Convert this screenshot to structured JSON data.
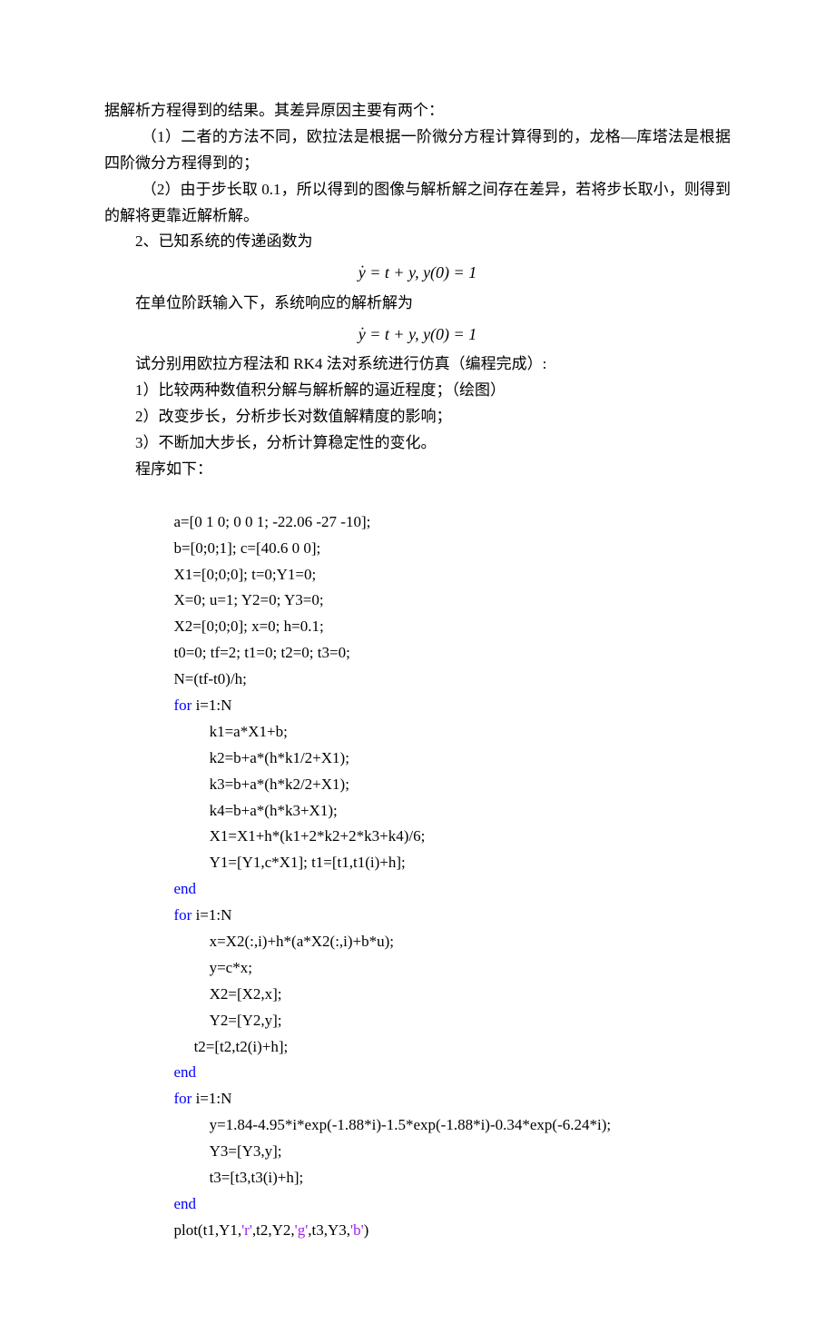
{
  "p1": "据解析方程得到的结果。其差异原因主要有两个：",
  "p2": "（1）二者的方法不同，欧拉法是根据一阶微分方程计算得到的，龙格—库塔法是根据四阶微分方程得到的；",
  "p3": "（2）由于步长取 0.1，所以得到的图像与解析解之间存在差异，若将步长取小，则得到的解将更靠近解析解。",
  "p4": "2、已知系统的传递函数为",
  "eq1_lhs": "y",
  "eq1_rhs": " = t + y, y(0) = 1",
  "p5": "在单位阶跃输入下，系统响应的解析解为",
  "eq2_lhs": "y",
  "eq2_rhs": " = t + y, y(0) = 1",
  "p6": "试分别用欧拉方程法和 RK4 法对系统进行仿真（编程完成）:",
  "p7": "1）比较两种数值积分解与解析解的逼近程度；（绘图）",
  "p8": "2）改变步长，分析步长对数值解精度的影响；",
  "p9": "3）不断加大步长，分析计算稳定性的变化。",
  "p10": "程序如下：",
  "code": {
    "l1": "a=[0 1 0; 0 0 1; -22.06 -27 -10];",
    "l2": "b=[0;0;1]; c=[40.6 0 0];",
    "l3": "X1=[0;0;0]; t=0;Y1=0;",
    "l4": "X=0; u=1; Y2=0; Y3=0;",
    "l5": "X2=[0;0;0]; x=0; h=0.1;",
    "l6": "t0=0; tf=2; t1=0; t2=0; t3=0;",
    "l7": "N=(tf-t0)/h;",
    "l8a": "for",
    "l8b": " i=1:N",
    "l9": "k1=a*X1+b;",
    "l10": "k2=b+a*(h*k1/2+X1);",
    "l11": "k3=b+a*(h*k2/2+X1);",
    "l12": "k4=b+a*(h*k3+X1);",
    "l13": "X1=X1+h*(k1+2*k2+2*k3+k4)/6;",
    "l14": "Y1=[Y1,c*X1]; t1=[t1,t1(i)+h];",
    "l15": "end",
    "l16a": "for",
    "l16b": " i=1:N",
    "l17": "x=X2(:,i)+h*(a*X2(:,i)+b*u);",
    "l18": "y=c*x;",
    "l19": "X2=[X2,x];",
    "l20": "Y2=[Y2,y];",
    "l21": "t2=[t2,t2(i)+h];",
    "l22": "end",
    "l23a": "for",
    "l23b": " i=1:N",
    "l24": "y=1.84-4.95*i*exp(-1.88*i)-1.5*exp(-1.88*i)-0.34*exp(-6.24*i);",
    "l25": "Y3=[Y3,y];",
    "l26": "t3=[t3,t3(i)+h];",
    "l27": "end",
    "l28a": "plot(t1,Y1,",
    "l28b": "'r'",
    "l28c": ",t2,Y2,",
    "l28d": "'g'",
    "l28e": ",t3,Y3,",
    "l28f": "'b'",
    "l28g": ")"
  }
}
